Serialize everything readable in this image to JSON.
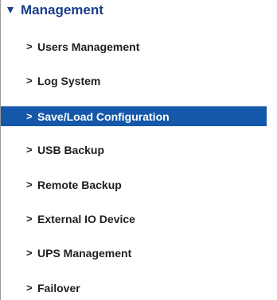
{
  "section": {
    "title": "Management",
    "expanded_icon": "triangle-down-icon"
  },
  "menu": {
    "chevron": ">",
    "items": [
      {
        "label": "Users Management",
        "active": false
      },
      {
        "label": "Log System",
        "active": false
      },
      {
        "label": "Save/Load Configuration",
        "active": true
      },
      {
        "label": "USB Backup",
        "active": false
      },
      {
        "label": "Remote Backup",
        "active": false
      },
      {
        "label": "External IO Device",
        "active": false
      },
      {
        "label": "UPS Management",
        "active": false
      },
      {
        "label": "Failover",
        "active": false
      }
    ]
  },
  "colors": {
    "accent": "#1a3e8c",
    "selected_background": "#1557a8",
    "selected_text": "#ffffff",
    "item_text": "#1f1f1f"
  }
}
